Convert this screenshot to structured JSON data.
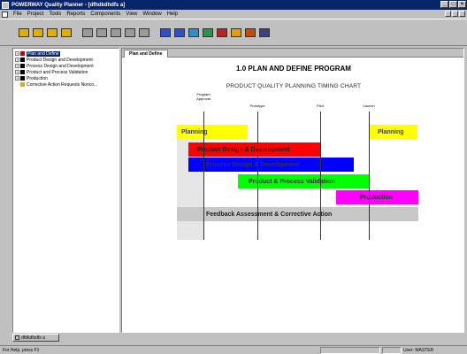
{
  "window": {
    "title": "POWERWAY Quality Planner - [dfhdkdhdfs a]"
  },
  "menu": [
    "File",
    "Project",
    "Tools",
    "Reports",
    "Components",
    "View",
    "Window",
    "Help"
  ],
  "toolbar": {
    "buttons": [
      {
        "icon": "open-folder-icon",
        "color": "#e0b000"
      },
      {
        "icon": "folder-icon",
        "color": "#e0b000"
      },
      {
        "icon": "copy-folder-icon",
        "color": "#e0b000"
      },
      {
        "icon": "paste-icon",
        "color": "#e0b000"
      },
      {
        "icon": "wrench-icon",
        "color": "#9a9a9a"
      },
      {
        "icon": "move-icon",
        "color": "#9a9a9a"
      },
      {
        "icon": "search-icon",
        "color": "#9a9a9a"
      },
      {
        "icon": "page-icon",
        "color": "#9a9a9a"
      },
      {
        "icon": "page-edit-icon",
        "color": "#9a9a9a"
      },
      {
        "icon": "process-icon",
        "color": "#2f4fc8"
      },
      {
        "icon": "diamond-icon",
        "color": "#2f4fc8"
      },
      {
        "icon": "chart-icon",
        "color": "#2f8fc8"
      },
      {
        "icon": "tools-icon",
        "color": "#2f8f4f"
      },
      {
        "icon": "flag-icon",
        "color": "#c02020"
      },
      {
        "icon": "pen-icon",
        "color": "#e0a000"
      },
      {
        "icon": "people-icon",
        "color": "#c05000"
      },
      {
        "icon": "building-icon",
        "color": "#404080"
      }
    ]
  },
  "tree": [
    {
      "label": "Plan and Define",
      "selected": true,
      "color": "#c00000"
    },
    {
      "label": "Product Design and Development",
      "selected": false,
      "color": "#000000"
    },
    {
      "label": "Process Design and Development",
      "selected": false,
      "color": "#000000"
    },
    {
      "label": "Product and Process Validation",
      "selected": false,
      "color": "#000000"
    },
    {
      "label": "Production",
      "selected": false,
      "color": "#000000"
    },
    {
      "label": "Corrective Action Requests Nonco...",
      "selected": false,
      "color": "#d8b000"
    }
  ],
  "tab": {
    "label": "Plan and Define"
  },
  "chart": {
    "title": "1.0 PLAN AND DEFINE PROGRAM",
    "subtitle": "PRODUCT QUALITY PLANNING TIMING CHART",
    "milestones": [
      {
        "label": "Program\nApproval"
      },
      {
        "label": "Prototype"
      },
      {
        "label": "Pilot"
      },
      {
        "label": "Launch"
      }
    ],
    "bars": [
      {
        "label": "Planning",
        "color": "#ffff00",
        "text_color": "#404040"
      },
      {
        "label": "Planning",
        "color": "#ffff00",
        "text_color": "#404040"
      },
      {
        "label": "Product Design & Development",
        "color": "#ff0000",
        "text_color": "#202020"
      },
      {
        "label": "Process Design & Development",
        "color": "#0000ff",
        "text_color": "#303060"
      },
      {
        "label": "Product & Process Validation",
        "color": "#00ff00",
        "text_color": "#303030"
      },
      {
        "label": "Production",
        "color": "#ff00ff",
        "text_color": "#303030"
      },
      {
        "label": "Feedback Assessment & Corrective Action",
        "color": "#c8c8c8",
        "text_color": "#202020"
      }
    ]
  },
  "window_button": {
    "label": "dfdkdfsdfs a"
  },
  "status": {
    "help": "For Help, press F1",
    "user": "User: MASTER"
  }
}
